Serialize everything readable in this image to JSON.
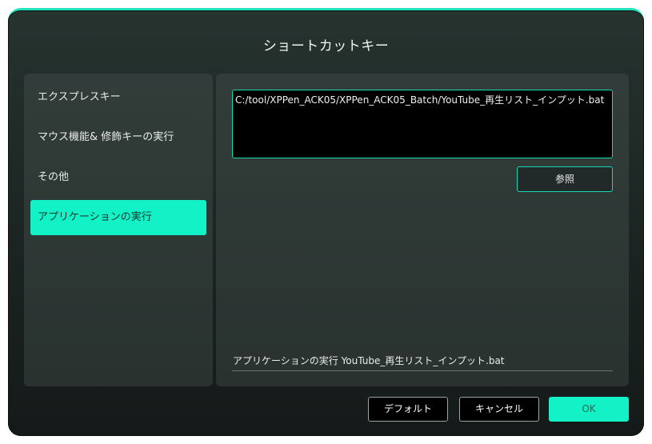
{
  "dialog": {
    "title": "ショートカットキー"
  },
  "sidebar": {
    "items": [
      {
        "label": "エクスプレスキー",
        "active": false
      },
      {
        "label": "マウス機能& 修飾キーの実行",
        "active": false
      },
      {
        "label": "その他",
        "active": false
      },
      {
        "label": "アプリケーションの実行",
        "active": true
      }
    ]
  },
  "app_launch": {
    "path_value": "C:/tool/XPPen_ACK05/XPPen_ACK05_Batch/YouTube_再生リスト_インプット.bat",
    "browse_label": "参照",
    "name_value": "アプリケーションの実行 YouTube_再生リスト_インプット.bat"
  },
  "footer": {
    "default_label": "デフォルト",
    "cancel_label": "キャンセル",
    "ok_label": "OK"
  },
  "colors": {
    "accent": "#13f2c7",
    "panel": "#2e3835",
    "dialog_bg": "#1b2422"
  }
}
